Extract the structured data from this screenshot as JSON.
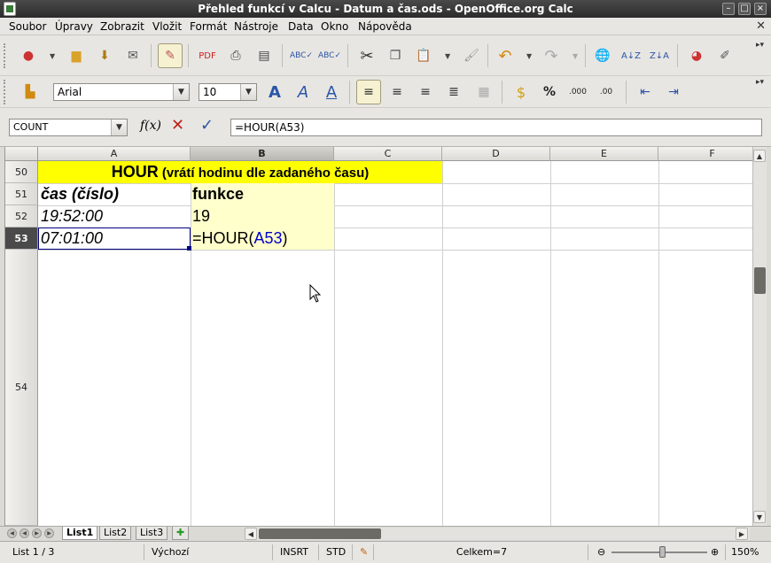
{
  "window": {
    "title": "Přehled funkcí v Calcu - Datum a čas.ods - OpenOffice.org Calc"
  },
  "menu": [
    "Soubor",
    "Úpravy",
    "Zobrazit",
    "Vložit",
    "Formát",
    "Nástroje",
    "Data",
    "Okno",
    "Nápověda"
  ],
  "formatting": {
    "font_name": "Arial",
    "font_size": "10"
  },
  "formula_bar": {
    "name_box": "COUNT",
    "formula": "=HOUR(A53)"
  },
  "columns": [
    "A",
    "B",
    "C",
    "D",
    "E",
    "F"
  ],
  "rows": [
    "50",
    "51",
    "52",
    "53",
    "54"
  ],
  "cells": {
    "title_bold": "HOUR",
    "title_rest": " (vrátí hodinu dle zadaného času)",
    "a51": "čas (číslo)",
    "b51": "funkce",
    "a52": "19:52:00",
    "b52": "19",
    "a53": "07:01:00",
    "b53_prefix": "=HOUR(",
    "b53_ref": "A53",
    "b53_suffix": ")"
  },
  "sheets": [
    "List1",
    "List2",
    "List3"
  ],
  "status": {
    "sheet": "List 1 / 3",
    "style": "Výchozí",
    "mode": "INSRT",
    "selection": "STD",
    "sum": "Celkem=7",
    "zoom": "150%"
  },
  "colors": {
    "title_fill": "#ffff00",
    "header_fill": "#ffffcc",
    "reference": "#0000cc"
  }
}
